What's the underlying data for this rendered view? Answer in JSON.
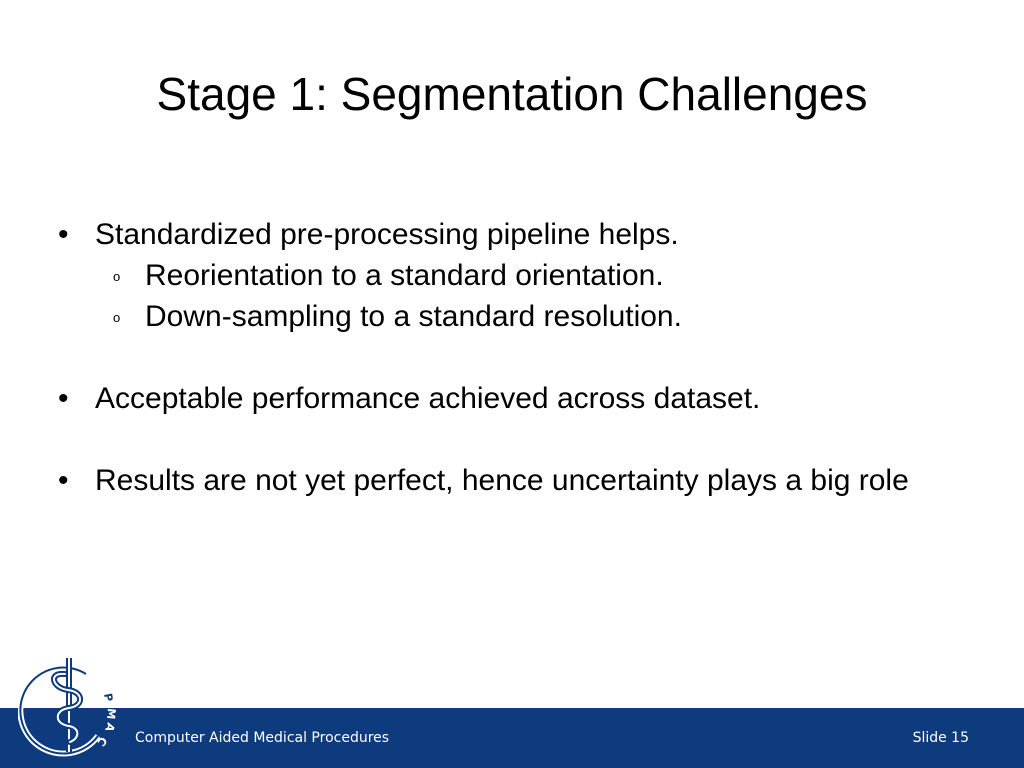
{
  "slide": {
    "title": "Stage 1: Segmentation Challenges",
    "bullets": [
      {
        "marker": "•",
        "text": "Standardized pre-processing pipeline helps.",
        "sub_items": [
          {
            "marker": "o",
            "text": "Reorientation to a standard orientation."
          },
          {
            "marker": "o",
            "text": "Down-sampling to a standard resolution."
          }
        ]
      },
      {
        "marker": "•",
        "text": "Acceptable performance achieved across dataset."
      },
      {
        "marker": "•",
        "text": "Results are not yet perfect, hence uncertainty plays a big role"
      }
    ]
  },
  "footer": {
    "organization": "Computer Aided Medical Procedures",
    "slide_number": "Slide 15",
    "background_color": "#0d3b7d"
  },
  "logo": {
    "icon": "camp-logo-icon",
    "text": "CAMP",
    "color": "#0d3b7d"
  }
}
